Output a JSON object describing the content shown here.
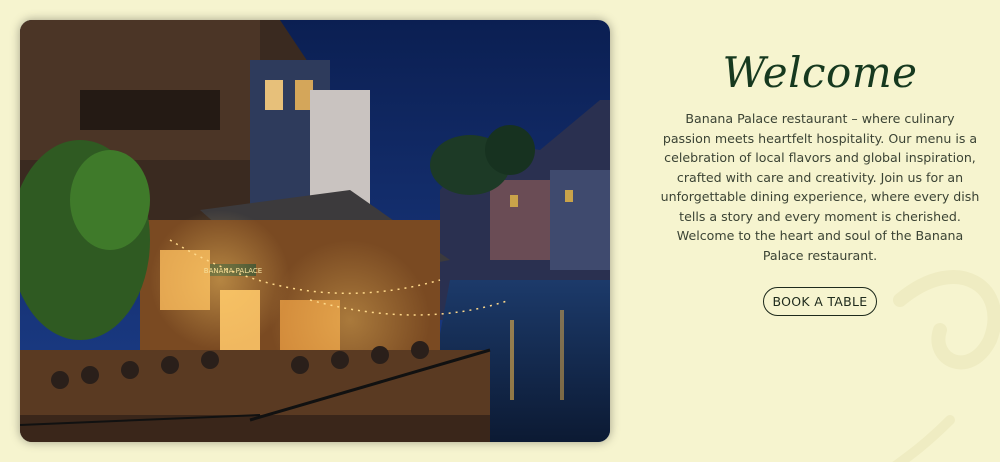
{
  "hero": {
    "title": "Welcome",
    "description": "Banana Palace restaurant – where culinary passion meets heartfelt hospitality. Our menu is a celebration of local flavors and global inspiration, crafted with care and creativity. Join us for an unforgettable dining experience, where every dish tells a story and every moment is cherished. Welcome to the heart and soul of the Banana Palace restaurant.",
    "cta_label": "BOOK A TABLE",
    "image_sign_text": "BANANA PALACE"
  },
  "colors": {
    "background": "#f6f4cf",
    "title": "#16391f",
    "text": "#3b4334"
  }
}
